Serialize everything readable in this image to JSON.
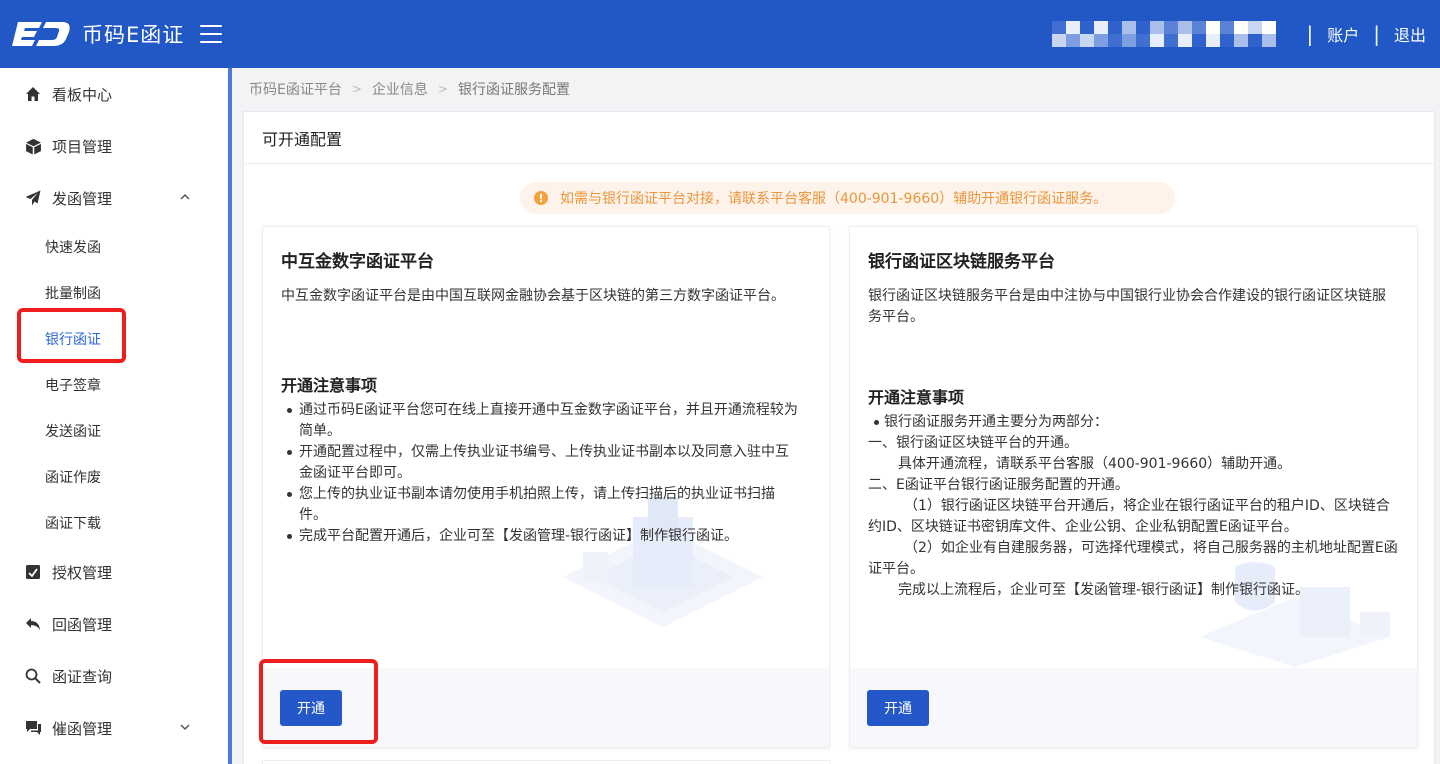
{
  "header": {
    "brand": "币码E函证",
    "account_label": "账户",
    "logout_label": "退出"
  },
  "sidebar": {
    "items": [
      {
        "label": "看板中心",
        "icon": "home-icon"
      },
      {
        "label": "项目管理",
        "icon": "cube-icon"
      },
      {
        "label": "发函管理",
        "icon": "send-icon",
        "expanded": true
      },
      {
        "label": "授权管理",
        "icon": "authorize-icon"
      },
      {
        "label": "回函管理",
        "icon": "reply-icon"
      },
      {
        "label": "函证查询",
        "icon": "search-icon"
      },
      {
        "label": "催函管理",
        "icon": "chat-icon"
      }
    ],
    "sub_items": [
      "快速发函",
      "批量制函",
      "银行函证",
      "电子签章",
      "发送函证",
      "函证作废",
      "函证下载"
    ],
    "active_sub": "银行函证"
  },
  "breadcrumb": [
    "币码E函证平台",
    "企业信息",
    "银行函证服务配置"
  ],
  "panel": {
    "title": "可开通配置",
    "notice": "如需与银行函证平台对接，请联系平台客服（400-901-9660）辅助开通银行函证服务。"
  },
  "cards": [
    {
      "title": "中互金数字函证平台",
      "desc": "中互金数字函证平台是由中国互联网金融协会基于区块链的第三方数字函证平台。",
      "notes_title": "开通注意事项",
      "notes": [
        "通过币码E函证平台您可在线上直接开通中互金数字函证平台，并且开通流程较为简单。",
        "开通配置过程中，仅需上传执业证书编号、上传执业证书副本以及同意入驻中互金函证平台即可。",
        "您上传的执业证书副本请勿使用手机拍照上传，请上传扫描后的执业证书扫描件。",
        "完成平台配置开通后，企业可至【发函管理-银行函证】制作银行函证。"
      ],
      "button": "开通"
    },
    {
      "title": "银行函证区块链服务平台",
      "desc": "银行函证区块链服务平台是由中注协与中国银行业协会合作建设的银行函证区块链服务平台。",
      "notes_title": "开通注意事项",
      "bullet": "银行函证服务开通主要分为两部分：",
      "lines": [
        "一、银行函证区块链平台的开通。",
        "具体开通流程，请联系平台客服（400-901-9660）辅助开通。",
        "二、E函证平台银行函证服务配置的开通。",
        "（1）银行函证区块链平台开通后，将企业在银行函证平台的租户ID、区块链合约ID、区块链证书密钥库文件、企业公钥、企业私钥配置E函证平台。",
        "（2）如企业有自建服务器，可选择代理模式，将自己服务器的主机地址配置E函证平台。",
        "完成以上流程后，企业可至【发函管理-银行函证】制作银行函证。"
      ],
      "button": "开通"
    }
  ],
  "colors": {
    "header_bg": "#2158c6",
    "accent": "#2458c8",
    "active_text": "#2b66d6",
    "notice_text": "#e9963c",
    "highlight": "#f01d1d"
  }
}
